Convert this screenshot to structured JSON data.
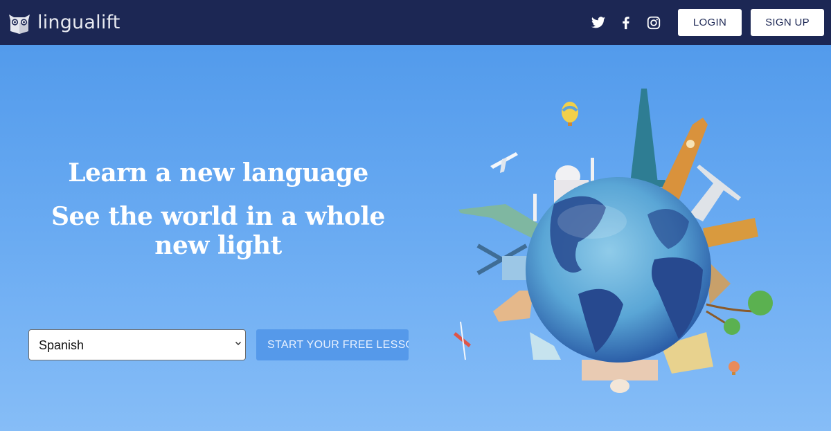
{
  "navbar": {
    "brand_name": "lingualift",
    "logo_icon": "owl-book-logo",
    "social_links": [
      {
        "name": "twitter",
        "icon": "twitter-icon"
      },
      {
        "name": "facebook",
        "icon": "facebook-icon"
      },
      {
        "name": "instagram",
        "icon": "instagram-icon"
      }
    ],
    "login_label": "LOGIN",
    "signup_label": "SIGN UP"
  },
  "hero": {
    "title": "Learn a new language",
    "subtitle": "See the world in a whole new light",
    "language_select": {
      "selected": "Spanish",
      "options": [
        "Spanish"
      ]
    },
    "cta_label": "START YOUR FREE LESSON",
    "illustration": "globe-with-world-landmarks"
  },
  "colors": {
    "navbar_bg": "#1c2754",
    "hero_bg_top": "#4d97ea",
    "hero_bg_bottom": "#86bdf7",
    "cta_bg": "#5599ea",
    "button_text": "#1c2754"
  }
}
